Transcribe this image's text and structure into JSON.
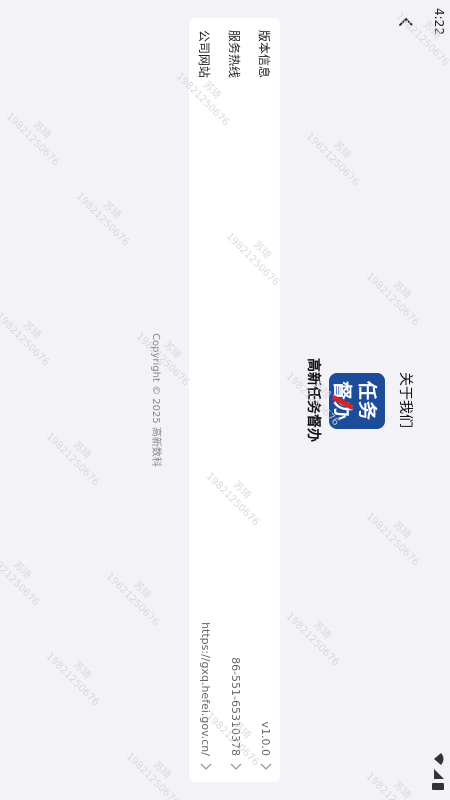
{
  "status_bar": {
    "time": "4:22"
  },
  "nav": {
    "title": "关于我们"
  },
  "logo": {
    "line1": "任务",
    "line2": "督办"
  },
  "app_name": "高新任务督办",
  "info_rows": [
    {
      "label": "版本信息",
      "value": "v1.0.0"
    },
    {
      "label": "服务热线",
      "value": "86-551-65310378"
    },
    {
      "label": "公司网站",
      "value": "https://gxq.hefei.gov.cn/"
    }
  ],
  "copyright": "Copyright © 2025 高新数科",
  "watermark": {
    "name": "苏琦",
    "phone": "19821250676"
  },
  "colors": {
    "background": "#f2f2f7",
    "card": "#ffffff",
    "logo_blue": "#1c4c9a",
    "logo_red": "#d8232a"
  }
}
